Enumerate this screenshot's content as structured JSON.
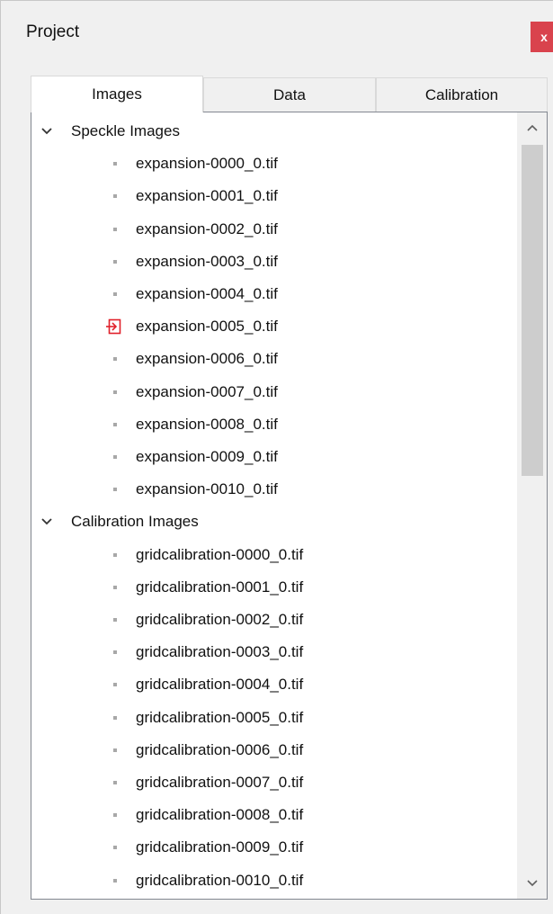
{
  "panel": {
    "title": "Project",
    "close_glyph": "x"
  },
  "tabs": [
    {
      "label": "Images",
      "active": true
    },
    {
      "label": "Data",
      "active": false
    },
    {
      "label": "Calibration",
      "active": false
    }
  ],
  "tree": {
    "groups": [
      {
        "label": "Speckle Images",
        "expanded": true,
        "items": [
          {
            "label": "expansion-0000_0.tif",
            "icon": "bullet"
          },
          {
            "label": "expansion-0001_0.tif",
            "icon": "bullet"
          },
          {
            "label": "expansion-0002_0.tif",
            "icon": "bullet"
          },
          {
            "label": "expansion-0003_0.tif",
            "icon": "bullet"
          },
          {
            "label": "expansion-0004_0.tif",
            "icon": "bullet"
          },
          {
            "label": "expansion-0005_0.tif",
            "icon": "current-image-arrow-icon"
          },
          {
            "label": "expansion-0006_0.tif",
            "icon": "bullet"
          },
          {
            "label": "expansion-0007_0.tif",
            "icon": "bullet"
          },
          {
            "label": "expansion-0008_0.tif",
            "icon": "bullet"
          },
          {
            "label": "expansion-0009_0.tif",
            "icon": "bullet"
          },
          {
            "label": "expansion-0010_0.tif",
            "icon": "bullet"
          }
        ]
      },
      {
        "label": "Calibration Images",
        "expanded": true,
        "items": [
          {
            "label": "gridcalibration-0000_0.tif",
            "icon": "bullet"
          },
          {
            "label": "gridcalibration-0001_0.tif",
            "icon": "bullet"
          },
          {
            "label": "gridcalibration-0002_0.tif",
            "icon": "bullet"
          },
          {
            "label": "gridcalibration-0003_0.tif",
            "icon": "bullet"
          },
          {
            "label": "gridcalibration-0004_0.tif",
            "icon": "bullet"
          },
          {
            "label": "gridcalibration-0005_0.tif",
            "icon": "bullet"
          },
          {
            "label": "gridcalibration-0006_0.tif",
            "icon": "bullet"
          },
          {
            "label": "gridcalibration-0007_0.tif",
            "icon": "bullet"
          },
          {
            "label": "gridcalibration-0008_0.tif",
            "icon": "bullet"
          },
          {
            "label": "gridcalibration-0009_0.tif",
            "icon": "bullet"
          },
          {
            "label": "gridcalibration-0010_0.tif",
            "icon": "bullet"
          }
        ]
      }
    ]
  },
  "colors": {
    "close_button": "#d9434d",
    "marker": "#e0202a",
    "scroll_thumb": "#cdcdcd"
  }
}
